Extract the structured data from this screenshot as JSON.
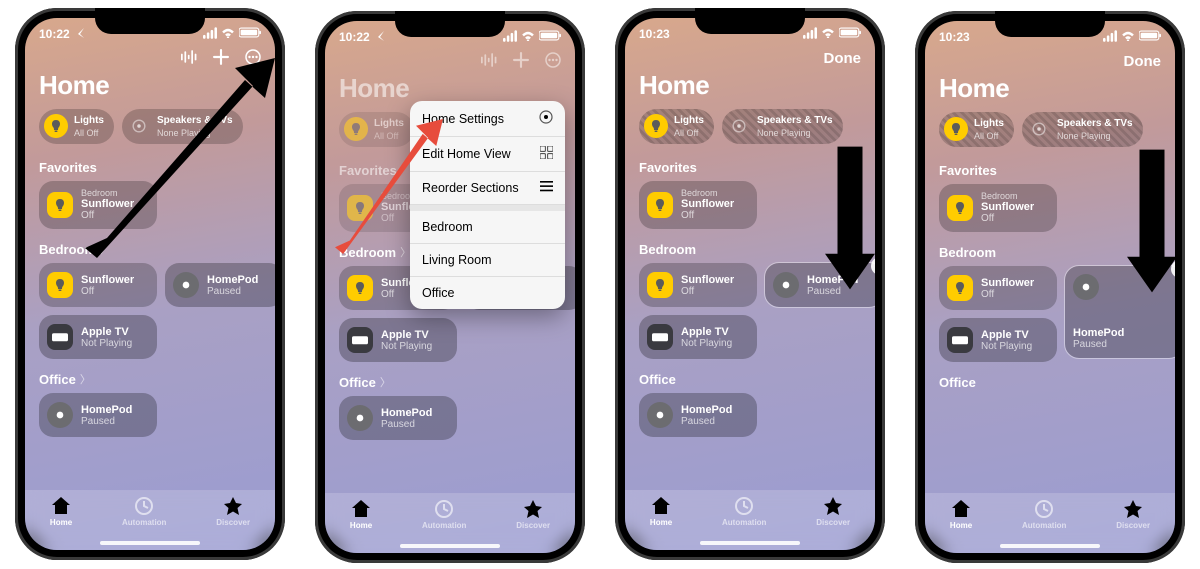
{
  "status": {
    "time_a": "10:22",
    "time_b": "10:23"
  },
  "nav": {
    "done": "Done"
  },
  "title": "Home",
  "chips": {
    "lights": {
      "label": "Lights",
      "sub": "All Off"
    },
    "speakers": {
      "label": "Speakers & TVs",
      "sub": "None Playing"
    }
  },
  "sections": {
    "favorites": {
      "label": "Favorites",
      "sunflower": {
        "over": "Bedroom",
        "name": "Sunflower",
        "sub": "Off"
      }
    },
    "bedroom": {
      "label": "Bedroom",
      "sunflower": {
        "name": "Sunflower",
        "sub": "Off"
      },
      "homepod": {
        "name": "HomePod",
        "sub": "Paused"
      },
      "appletv": {
        "name": "Apple TV",
        "sub": "Not Playing"
      }
    },
    "office": {
      "label": "Office",
      "homepod": {
        "name": "HomePod",
        "sub": "Paused"
      }
    }
  },
  "menu": {
    "home_settings": "Home Settings",
    "edit_home_view": "Edit Home View",
    "reorder_sections": "Reorder Sections",
    "bedroom": "Bedroom",
    "living_room": "Living Room",
    "office": "Office"
  },
  "tabs": {
    "home": "Home",
    "automation": "Automation",
    "discover": "Discover"
  }
}
